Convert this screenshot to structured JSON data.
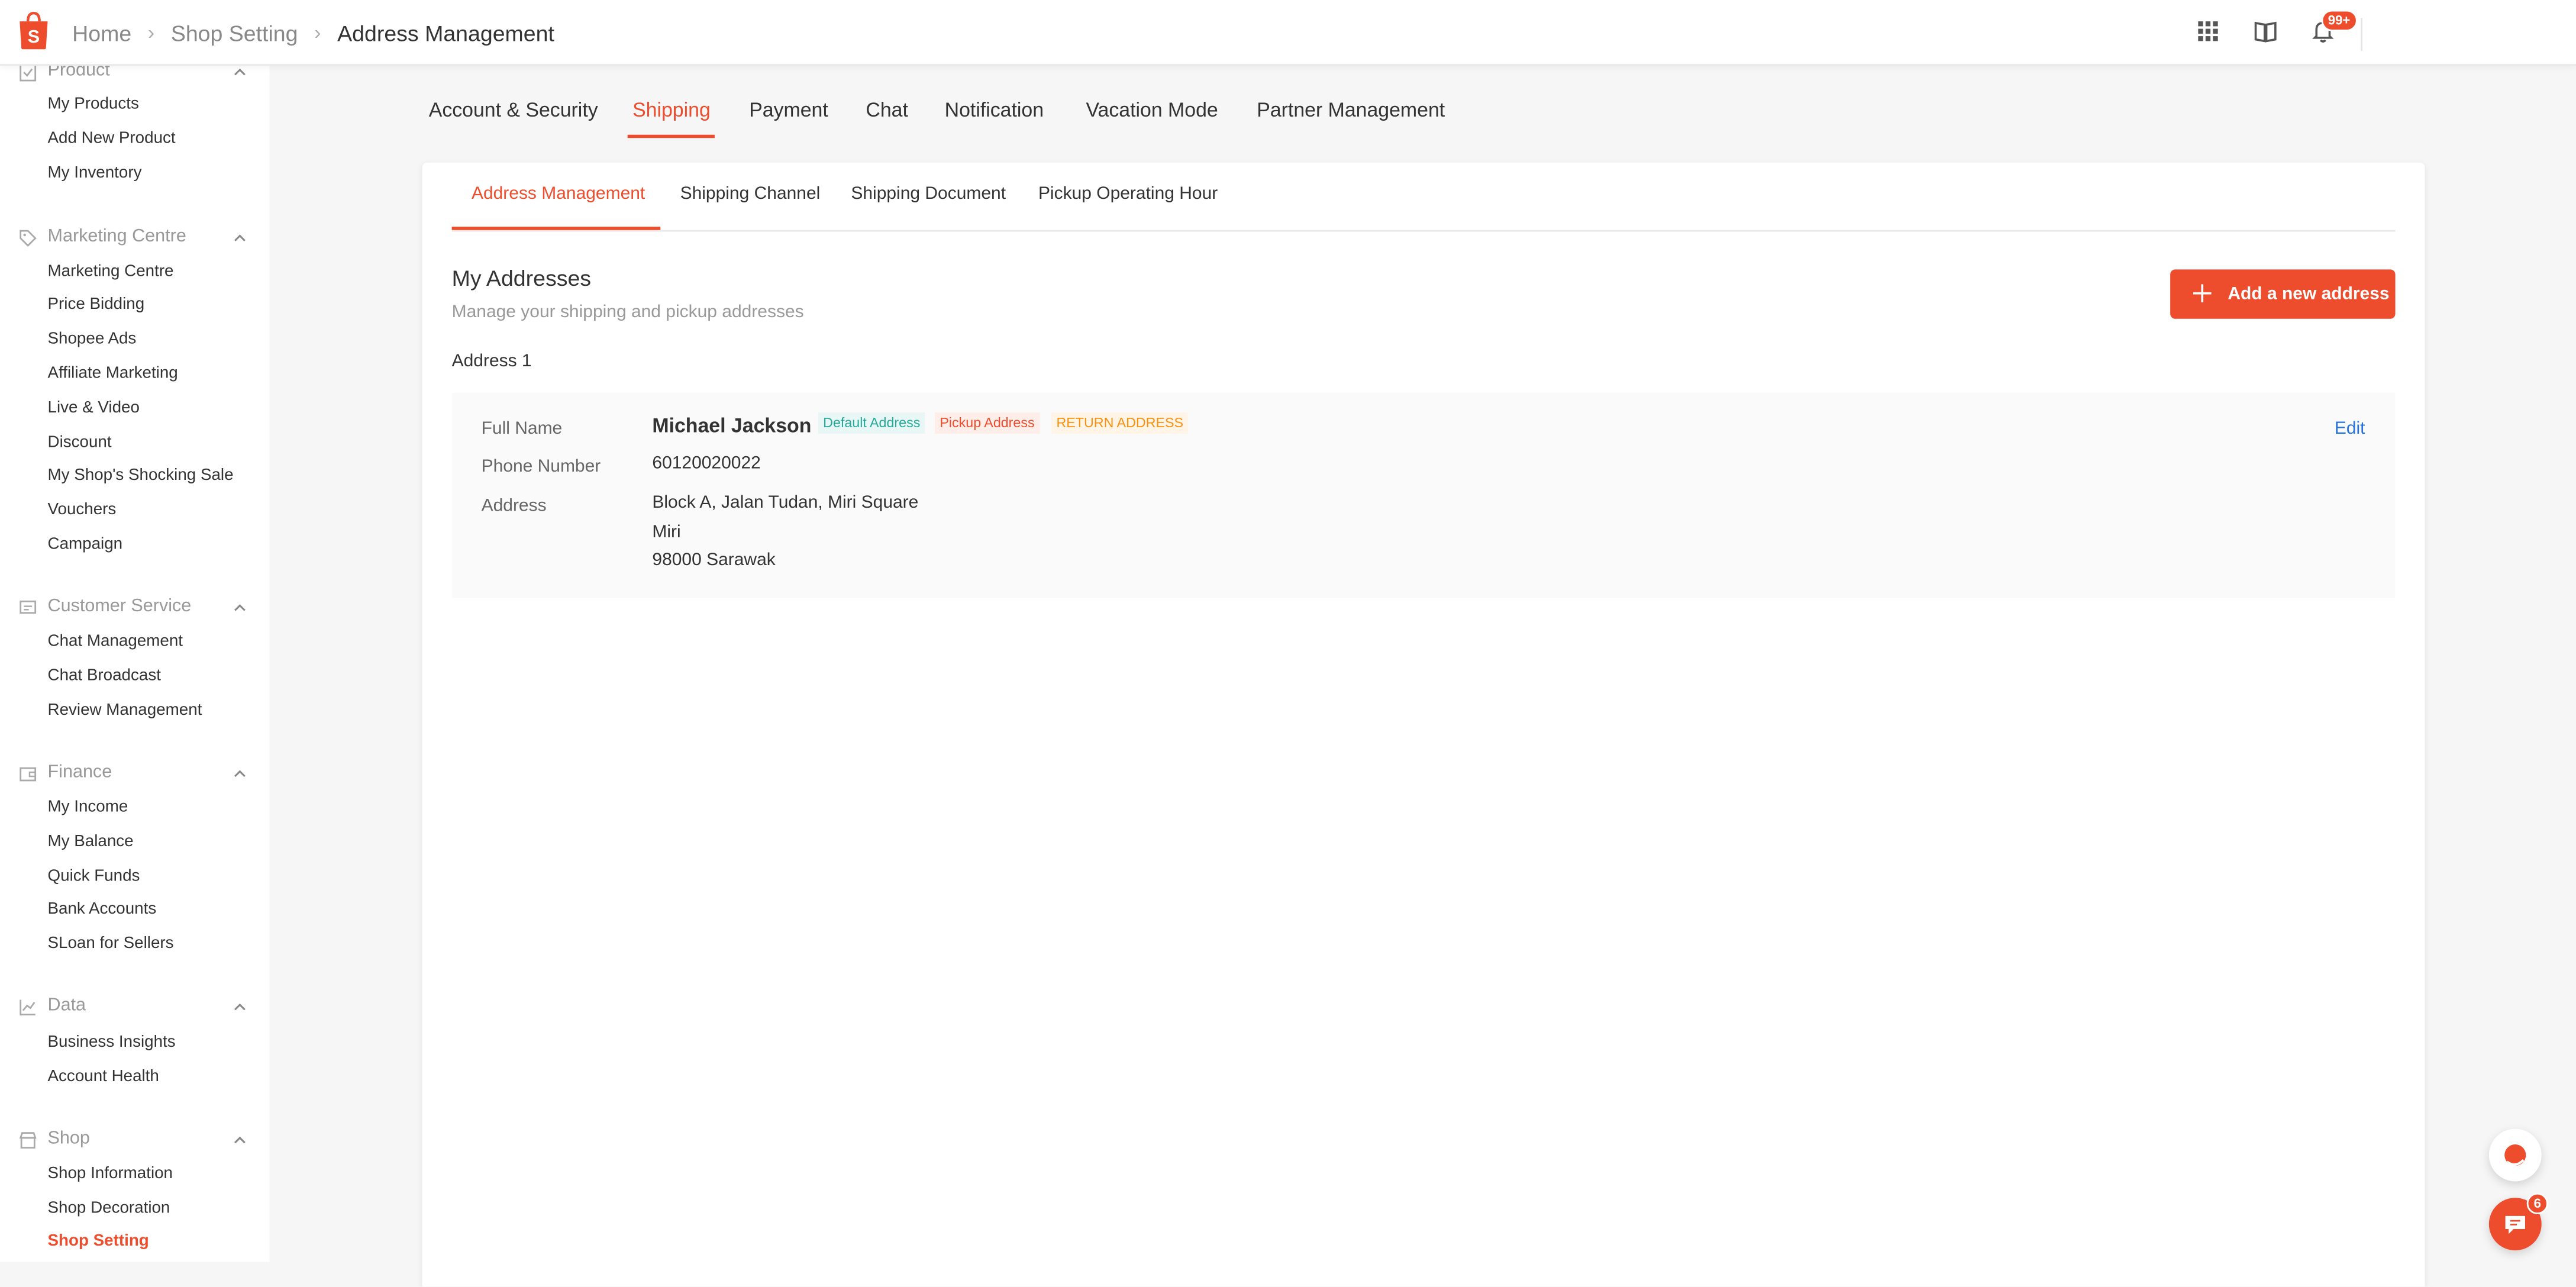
{
  "header": {
    "breadcrumb": [
      "Home",
      "Shop Setting",
      "Address Management"
    ],
    "notification_badge": "99+",
    "brand_color": "#ee4d2d"
  },
  "sidebar": {
    "sections": [
      {
        "title": "Product",
        "icon": "clipboard-icon",
        "items": [
          "My Products",
          "Add New Product",
          "My Inventory"
        ]
      },
      {
        "title": "Marketing Centre",
        "icon": "tag-icon",
        "items": [
          "Marketing Centre",
          "Price Bidding",
          "Shopee Ads",
          "Affiliate Marketing",
          "Live & Video",
          "Discount",
          "My Shop's Shocking Sale",
          "Vouchers",
          "Campaign"
        ]
      },
      {
        "title": "Customer Service",
        "icon": "chat-bubble-icon",
        "items": [
          "Chat Management",
          "Chat Broadcast",
          "Review Management"
        ]
      },
      {
        "title": "Finance",
        "icon": "wallet-icon",
        "items": [
          "My Income",
          "My Balance",
          "Quick Funds",
          "Bank Accounts",
          "SLoan for Sellers"
        ]
      },
      {
        "title": "Data",
        "icon": "chart-icon",
        "items": [
          "Business Insights",
          "Account Health"
        ]
      },
      {
        "title": "Shop",
        "icon": "store-icon",
        "items": [
          "Shop Information",
          "Shop Decoration",
          "Shop Setting"
        ]
      }
    ],
    "active_item": "Shop Setting"
  },
  "main_tabs": [
    "Account & Security",
    "Shipping",
    "Payment",
    "Chat",
    "Notification",
    "Vacation Mode",
    "Partner Management"
  ],
  "active_main_tab": "Shipping",
  "sub_tabs": [
    "Address Management",
    "Shipping Channel",
    "Shipping Document",
    "Pickup Operating Hour"
  ],
  "active_sub_tab": "Address Management",
  "addresses_section": {
    "title": "My Addresses",
    "subtitle": "Manage your shipping and pickup addresses",
    "add_button": "Add a new address",
    "address_label": "Address 1"
  },
  "address": {
    "full_name_label": "Full Name",
    "full_name": "Michael Jackson",
    "tags": [
      "Default Address",
      "Pickup Address",
      "RETURN ADDRESS"
    ],
    "phone_label": "Phone Number",
    "phone": "60120020022",
    "address_label": "Address",
    "lines": [
      "Block A, Jalan Tudan, Miri Square",
      "Miri",
      "98000 Sarawak"
    ],
    "edit": "Edit"
  },
  "chat_badge": "6"
}
